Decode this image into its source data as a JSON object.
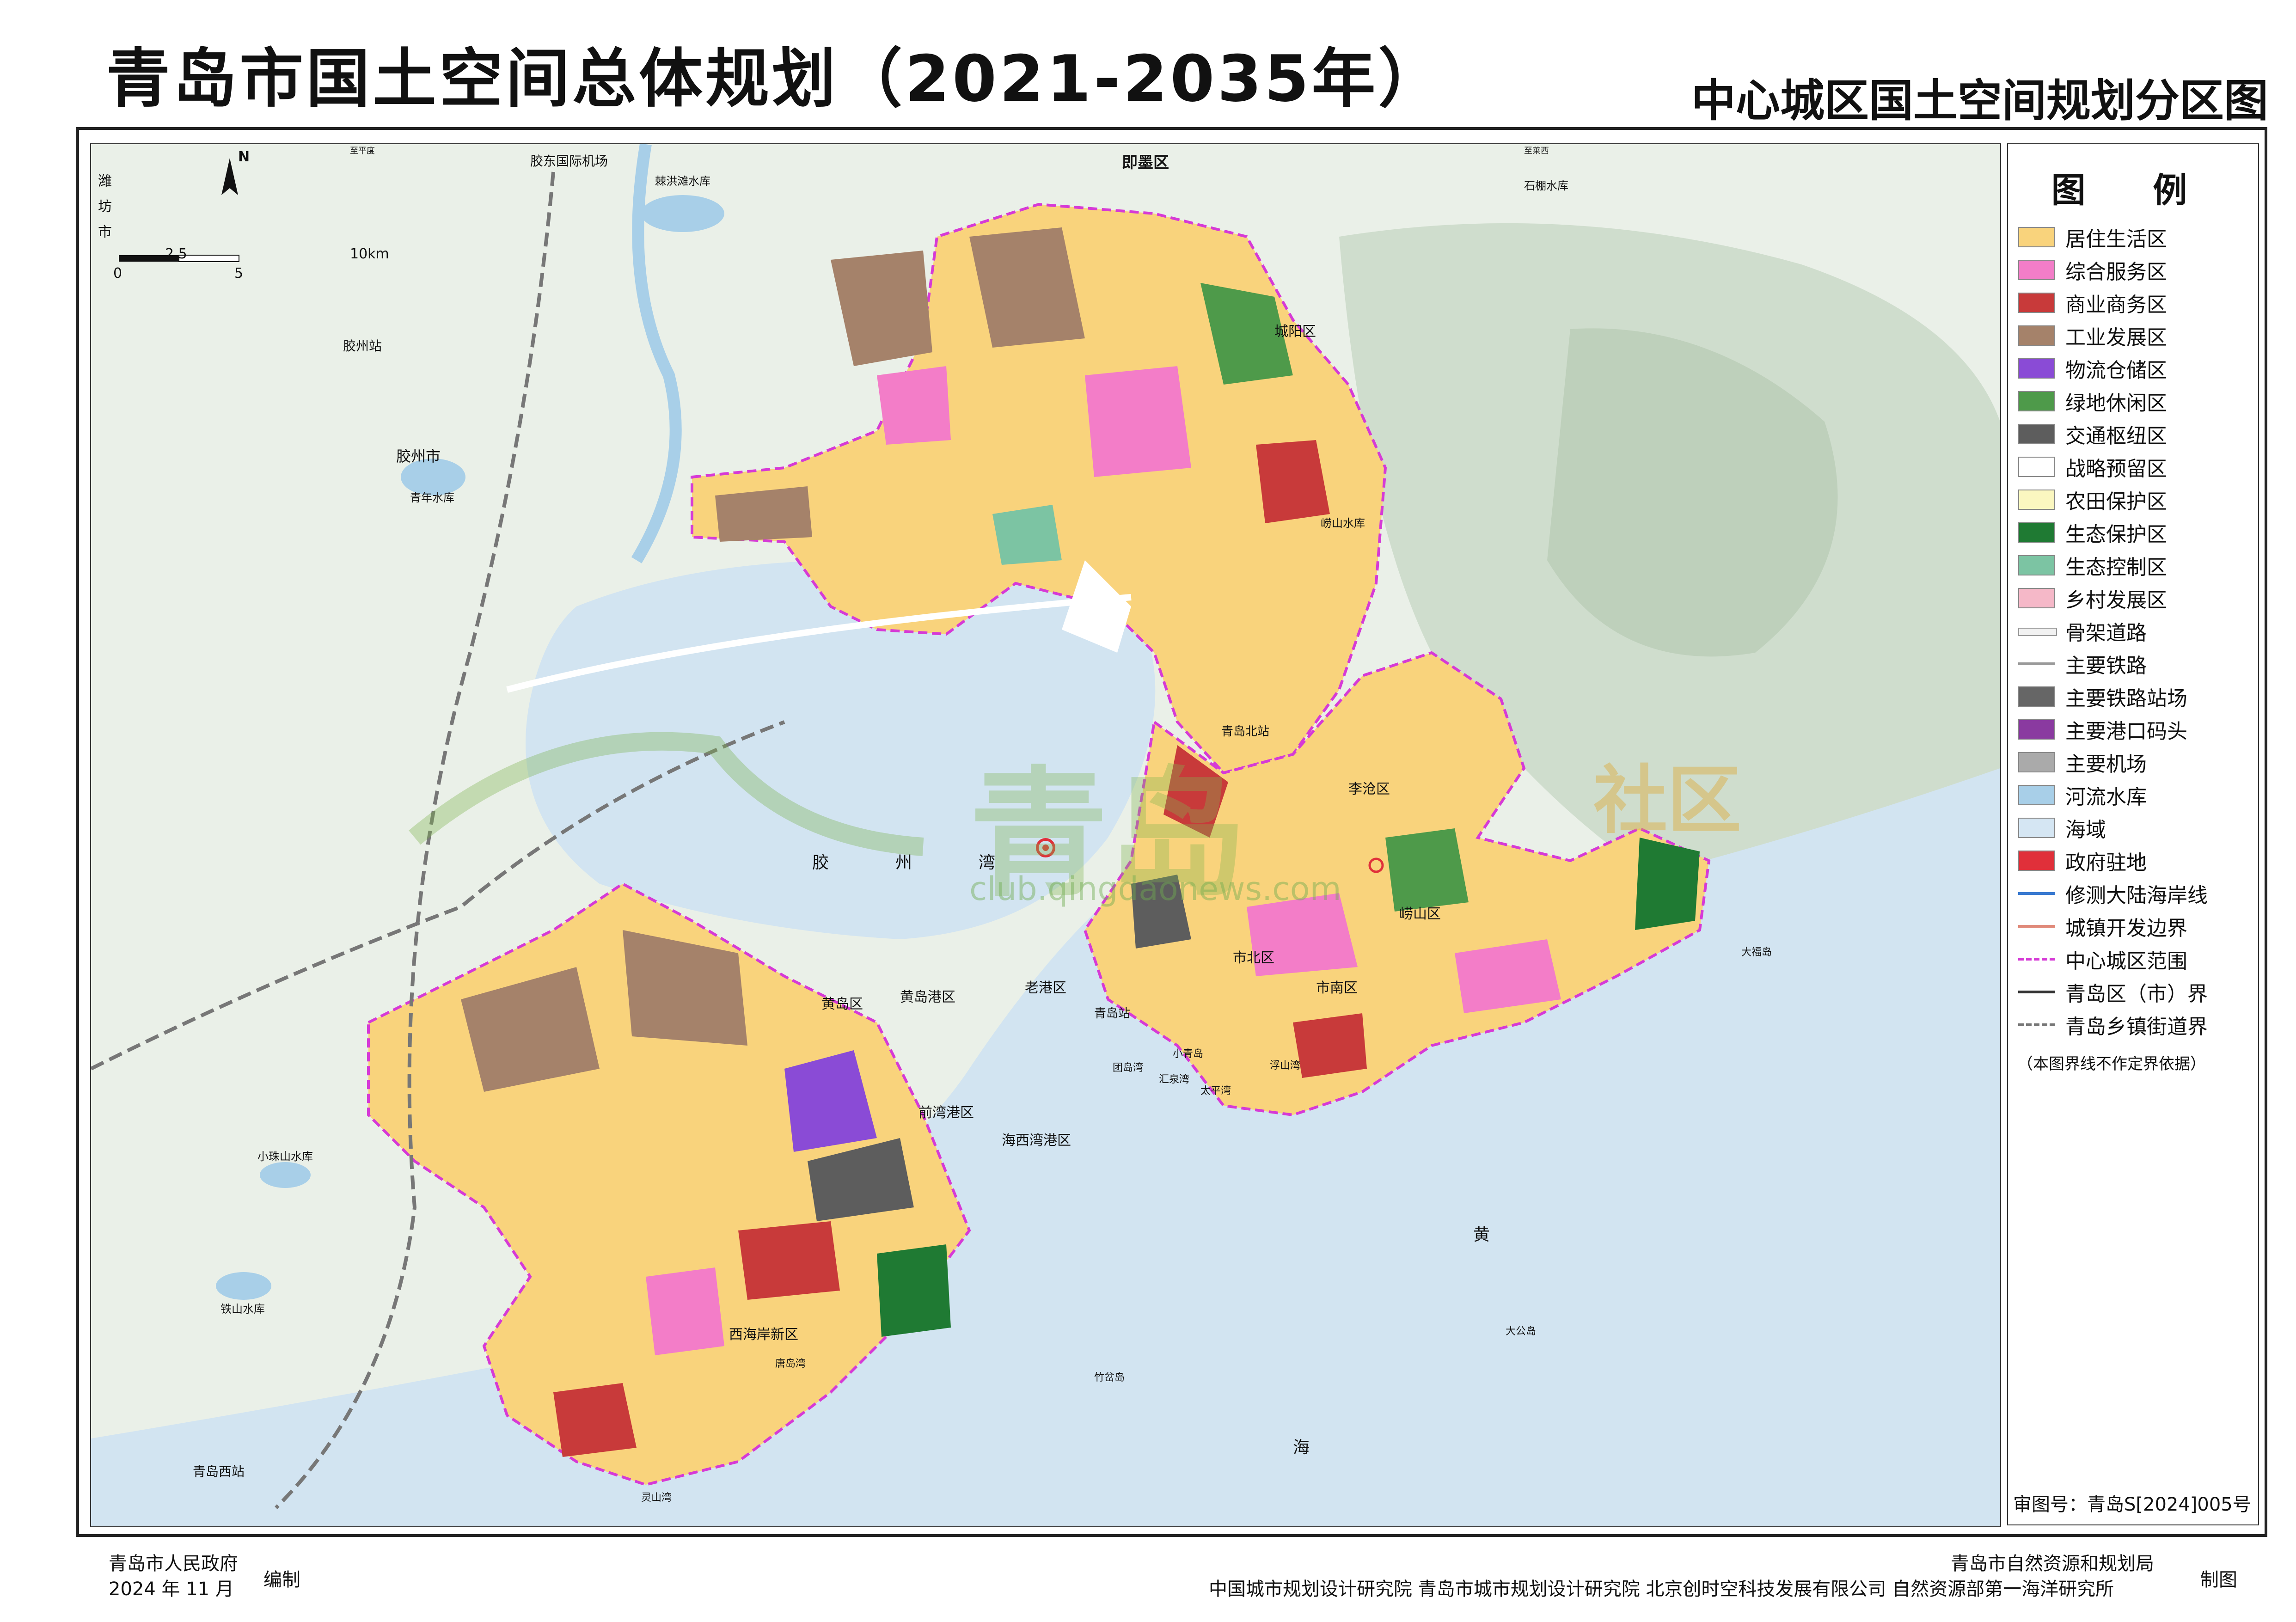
{
  "header": {
    "title": "青岛市国土空间总体规划（2021-2035年）",
    "subtitle": "中心城区国土空间规划分区图"
  },
  "legend": {
    "title": "图 例",
    "items": [
      {
        "label": "居住生活区",
        "color": "#f9d37c"
      },
      {
        "label": "综合服务区",
        "color": "#f37dc8"
      },
      {
        "label": "商业商务区",
        "color": "#c83a3a"
      },
      {
        "label": "工业发展区",
        "color": "#a5826a"
      },
      {
        "label": "物流仓储区",
        "color": "#8a4bd6"
      },
      {
        "label": "绿地休闲区",
        "color": "#4e9a4a"
      },
      {
        "label": "交通枢纽区",
        "color": "#5d5d5d"
      },
      {
        "label": "战略预留区",
        "color": "#ffffff"
      },
      {
        "label": "农田保护区",
        "color": "#fbf7c0"
      },
      {
        "label": "生态保护区",
        "color": "#1f7a33"
      },
      {
        "label": "生态控制区",
        "color": "#7cc4a3"
      },
      {
        "label": "乡村发展区",
        "color": "#f5b8c8"
      },
      {
        "label": "骨架道路",
        "color": "#f2f2f2"
      },
      {
        "label": "主要铁路",
        "color": "#9a9a9a"
      },
      {
        "label": "主要铁路站场",
        "color": "#666666"
      },
      {
        "label": "主要港口码头",
        "color": "#8a3aa0"
      },
      {
        "label": "主要机场",
        "color": "#aaaaaa"
      },
      {
        "label": "河流水库",
        "color": "#a8cfe8"
      },
      {
        "label": "海域",
        "color": "#d5e6f3"
      },
      {
        "label": "政府驻地",
        "color": "#e0303a"
      },
      {
        "label": "修测大陆海岸线",
        "color": "#3a7ad0"
      },
      {
        "label": "城镇开发边界",
        "color": "#e08a7a"
      },
      {
        "label": "中心城区范围",
        "color": "#d63ad6"
      },
      {
        "label": "青岛区（市）界",
        "color": "#333333"
      },
      {
        "label": "青岛乡镇街道界",
        "color": "#777777"
      }
    ],
    "note": "（本图界线不作定界依据）"
  },
  "approval_number": "审图号：青岛S[2024]005号",
  "footer": {
    "government": "青岛市人民政府",
    "date": "2024 年 11 月",
    "compiled_label": "编制",
    "bureau": "青岛市自然资源和规划局",
    "institutes": "中国城市规划设计研究院  青岛市城市规划设计研究院  北京创时空科技发展有限公司  自然资源部第一海洋研究所",
    "made_label": "制图"
  },
  "scale_bar": {
    "north": "N",
    "labels": [
      "0",
      "2.5",
      "5",
      "10km"
    ]
  },
  "watermark": {
    "text": "青岛",
    "suffix": "社区",
    "url": "club.qingdaonews.com"
  },
  "map_labels": {
    "districts": [
      "即墨区",
      "城阳区",
      "李沧区",
      "崂山区",
      "市北区",
      "市南区",
      "黄岛区",
      "西海岸新区",
      "胶州市"
    ],
    "stations": [
      "胶州站",
      "胶东国际机场",
      "青岛北站",
      "青岛站",
      "青岛西站"
    ],
    "ports": [
      "黄岛港区",
      "前湾港区",
      "海西湾港区",
      "老港区"
    ],
    "water": [
      "胶",
      "州",
      "湾",
      "黄",
      "海",
      "青年水库",
      "崂山水库",
      "小珠山水库",
      "铁山水库",
      "棘洪滩水库",
      "石棚水库"
    ],
    "islands": [
      "竹岔岛",
      "大公岛",
      "团岛湾",
      "浮山湾",
      "太平湾",
      "汇泉湾",
      "灵山湾",
      "唐岛湾",
      "小青岛",
      "大福岛"
    ],
    "neighbors": [
      "潍",
      "坊",
      "市",
      "至平度",
      "至莱西"
    ]
  }
}
